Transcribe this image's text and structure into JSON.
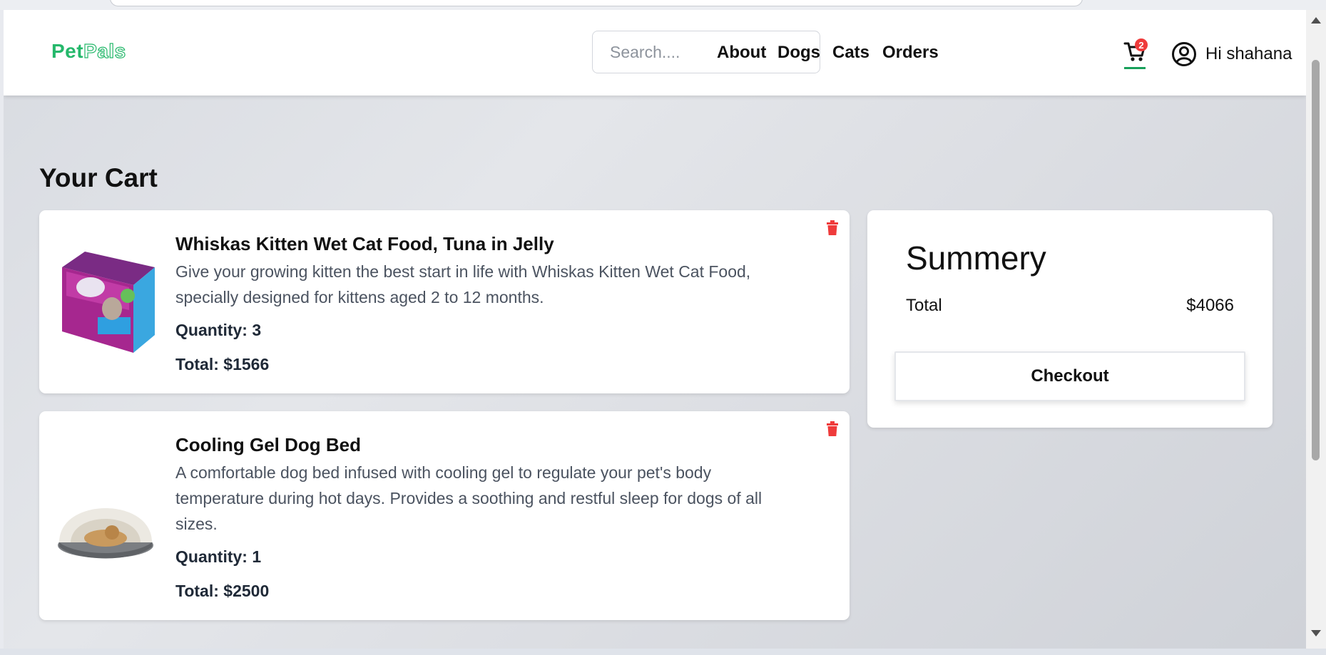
{
  "header": {
    "logo": {
      "part1": "Pet",
      "part2": "Pals"
    },
    "search": {
      "placeholder": "Search...."
    },
    "nav": {
      "about": "About",
      "dogs": "Dogs",
      "cats": "Cats",
      "orders": "Orders"
    },
    "cart": {
      "badge_count": "2",
      "icon": "cart-icon"
    },
    "user": {
      "icon": "user-circle-icon",
      "greeting": "Hi shahana"
    }
  },
  "page": {
    "title": "Your Cart"
  },
  "cart_items": [
    {
      "name": "Whiskas Kitten Wet Cat Food, Tuna in Jelly",
      "description": "Give your growing kitten the best start in life with Whiskas Kitten Wet Cat Food, specially designed for kittens aged 2 to 12 months.",
      "quantity_label": "Quantity: 3",
      "total_label": "Total: $1566",
      "image": "cat-food-box-image"
    },
    {
      "name": "Cooling Gel Dog Bed",
      "description": "A comfortable dog bed infused with cooling gel to regulate your pet's body temperature during hot days. Provides a soothing and restful sleep for dogs of all sizes.",
      "quantity_label": "Quantity: 1",
      "total_label": "Total: $2500",
      "image": "dog-bed-image"
    }
  ],
  "summary": {
    "title": "Summery",
    "total_label": "Total",
    "total_value": "$4066",
    "checkout_label": "Checkout"
  },
  "colors": {
    "brand": "#25b86b",
    "delete": "#ef3b3b",
    "cart_underline": "#17a05a"
  }
}
